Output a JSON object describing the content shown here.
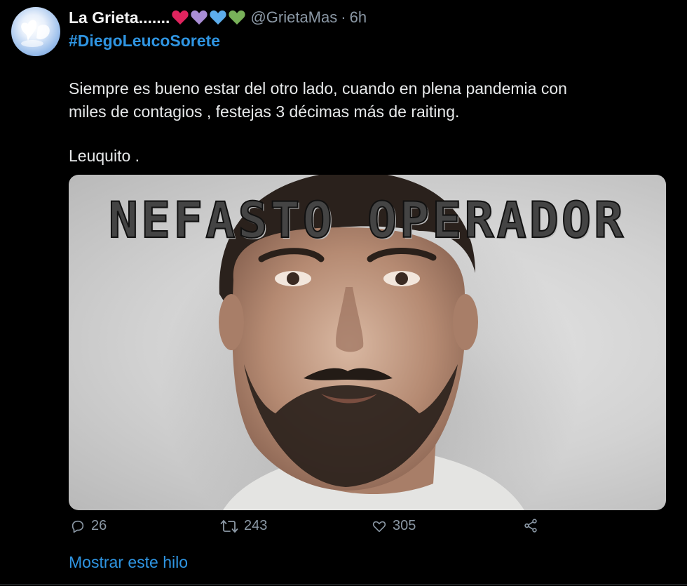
{
  "tweet": {
    "display_name": "La Grieta.......",
    "name_emojis": [
      {
        "icon": "red-heart-icon",
        "color": "#e0245e"
      },
      {
        "icon": "purple-heart-icon",
        "color": "#aa8ed6"
      },
      {
        "icon": "blue-heart-icon",
        "color": "#5dadec"
      },
      {
        "icon": "green-heart-icon",
        "color": "#78b159"
      }
    ],
    "handle": "@GrietaMas",
    "separator": "·",
    "time": "6h",
    "hashtag": "#DiegoLeucoSorete",
    "body_lines": [
      "Siempre es bueno estar del otro lado, cuando en plena pandemia con",
      "miles de contagios , festejas 3 décimas más de raiting."
    ],
    "signature": "Leuquito .",
    "image_overlay_text": "NEFASTO OPERADOR",
    "actions": {
      "reply_count": "26",
      "retweet_count": "243",
      "like_count": "305"
    },
    "thread_link": "Mostrar este hilo"
  },
  "colors": {
    "background": "#000000",
    "link_blue": "#2f95e2",
    "muted_text": "#8b98a5",
    "primary_text": "#e7e9ea"
  }
}
